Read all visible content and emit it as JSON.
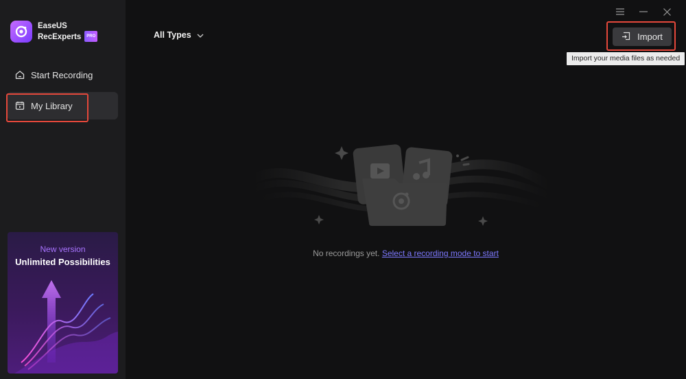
{
  "app": {
    "name_line1": "EaseUS",
    "name_line2": "RecExperts",
    "badge": "PRO"
  },
  "sidebar": {
    "items": [
      {
        "label": "Start Recording",
        "icon": "home-icon",
        "active": false
      },
      {
        "label": "My Library",
        "icon": "library-icon",
        "active": true
      }
    ]
  },
  "promo": {
    "subtitle": "New version",
    "title": "Unlimited Possibilities"
  },
  "toolbar": {
    "filter_label": "All Types",
    "import_label": "Import",
    "import_tooltip": "Import your media files as needed"
  },
  "empty_state": {
    "message": "No recordings yet.",
    "link": "Select a recording mode to start"
  },
  "colors": {
    "accent": "#7d79ff",
    "highlight": "#e5483b",
    "brand": "#a874ff"
  }
}
